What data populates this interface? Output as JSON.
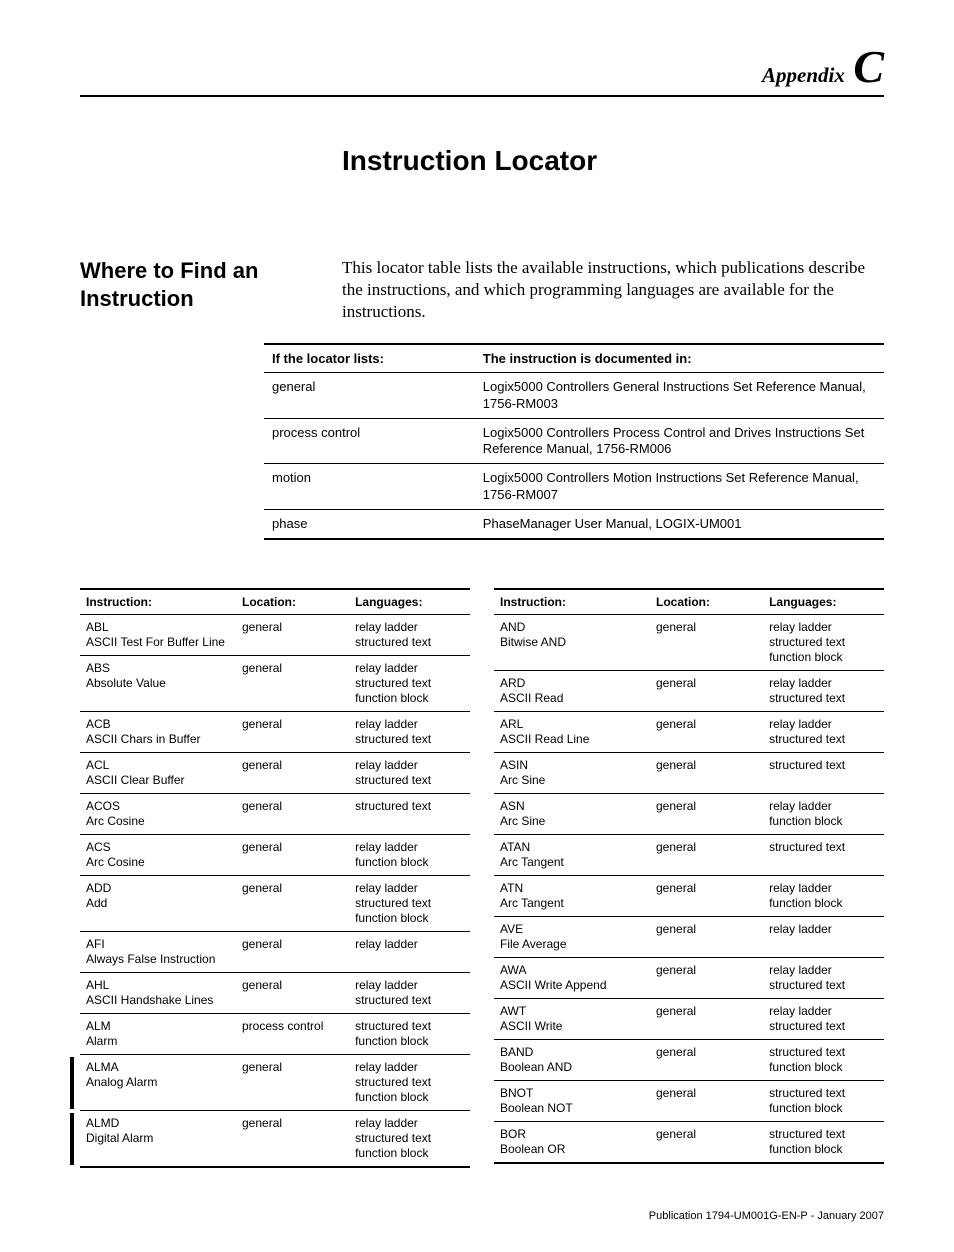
{
  "header": {
    "appendix_label": "Appendix",
    "appendix_letter": "C",
    "chapter_title": "Instruction Locator"
  },
  "section": {
    "heading": "Where to Find an Instruction",
    "intro": "This locator table lists the available instructions, which publications describe the instructions, and which programming languages are available for the instructions."
  },
  "locator_lookup": {
    "col1": "If the locator lists:",
    "col2": "The instruction is documented in:",
    "rows": [
      {
        "k": "general",
        "v": "Logix5000 Controllers General Instructions Set Reference Manual, 1756-RM003"
      },
      {
        "k": "process control",
        "v": "Logix5000 Controllers Process Control and Drives Instructions Set Reference Manual, 1756-RM006"
      },
      {
        "k": "motion",
        "v": "Logix5000 Controllers Motion Instructions Set Reference Manual, 1756-RM007"
      },
      {
        "k": "phase",
        "v": "PhaseManager User Manual, LOGIX-UM001"
      }
    ]
  },
  "instr_headers": {
    "instruction": "Instruction:",
    "location": "Location:",
    "languages": "Languages:"
  },
  "left_table": [
    {
      "code": "ABL",
      "desc": "ASCII Test For Buffer Line",
      "loc": "general",
      "lang": "relay ladder\nstructured text"
    },
    {
      "code": "ABS",
      "desc": "Absolute Value",
      "loc": "general",
      "lang": "relay ladder\nstructured text\nfunction block"
    },
    {
      "code": "ACB",
      "desc": "ASCII Chars in Buffer",
      "loc": "general",
      "lang": "relay ladder\nstructured text"
    },
    {
      "code": "ACL",
      "desc": "ASCII Clear Buffer",
      "loc": "general",
      "lang": "relay ladder\nstructured text"
    },
    {
      "code": "ACOS",
      "desc": "Arc Cosine",
      "loc": "general",
      "lang": "structured text"
    },
    {
      "code": "ACS",
      "desc": "Arc Cosine",
      "loc": "general",
      "lang": "relay ladder\nfunction block"
    },
    {
      "code": "ADD",
      "desc": "Add",
      "loc": "general",
      "lang": "relay ladder\nstructured text\nfunction block"
    },
    {
      "code": "AFI",
      "desc": "Always False Instruction",
      "loc": "general",
      "lang": "relay ladder"
    },
    {
      "code": "AHL",
      "desc": "ASCII Handshake Lines",
      "loc": "general",
      "lang": "relay ladder\nstructured text"
    },
    {
      "code": "ALM",
      "desc": "Alarm",
      "loc": "process control",
      "lang": "structured text\nfunction block"
    },
    {
      "code": "ALMA",
      "desc": "Analog Alarm",
      "loc": "general",
      "lang": "relay ladder\nstructured text\nfunction block",
      "changebar": true
    },
    {
      "code": "ALMD",
      "desc": "Digital Alarm",
      "loc": "general",
      "lang": "relay ladder\nstructured text\nfunction block",
      "changebar": true
    }
  ],
  "right_table": [
    {
      "code": "AND",
      "desc": "Bitwise AND",
      "loc": "general",
      "lang": "relay ladder\nstructured text\nfunction block"
    },
    {
      "code": "ARD",
      "desc": "ASCII Read",
      "loc": "general",
      "lang": "relay ladder\nstructured text"
    },
    {
      "code": "ARL",
      "desc": "ASCII Read Line",
      "loc": "general",
      "lang": "relay ladder\nstructured text"
    },
    {
      "code": "ASIN",
      "desc": "Arc Sine",
      "loc": "general",
      "lang": "structured text"
    },
    {
      "code": "ASN",
      "desc": "Arc Sine",
      "loc": "general",
      "lang": "relay ladder\nfunction block"
    },
    {
      "code": "ATAN",
      "desc": "Arc Tangent",
      "loc": "general",
      "lang": "structured text"
    },
    {
      "code": "ATN",
      "desc": "Arc Tangent",
      "loc": "general",
      "lang": "relay ladder\nfunction block"
    },
    {
      "code": "AVE",
      "desc": "File Average",
      "loc": "general",
      "lang": "relay ladder"
    },
    {
      "code": "AWA",
      "desc": "ASCII Write Append",
      "loc": "general",
      "lang": "relay ladder\nstructured text"
    },
    {
      "code": "AWT",
      "desc": "ASCII Write",
      "loc": "general",
      "lang": "relay ladder\nstructured text"
    },
    {
      "code": "BAND",
      "desc": "Boolean AND",
      "loc": "general",
      "lang": "structured text\nfunction block"
    },
    {
      "code": "BNOT",
      "desc": "Boolean NOT",
      "loc": "general",
      "lang": "structured text\nfunction block"
    },
    {
      "code": "BOR",
      "desc": "Boolean OR",
      "loc": "general",
      "lang": "structured text\nfunction block"
    }
  ],
  "footer": "Publication 1794-UM001G-EN-P - January 2007"
}
